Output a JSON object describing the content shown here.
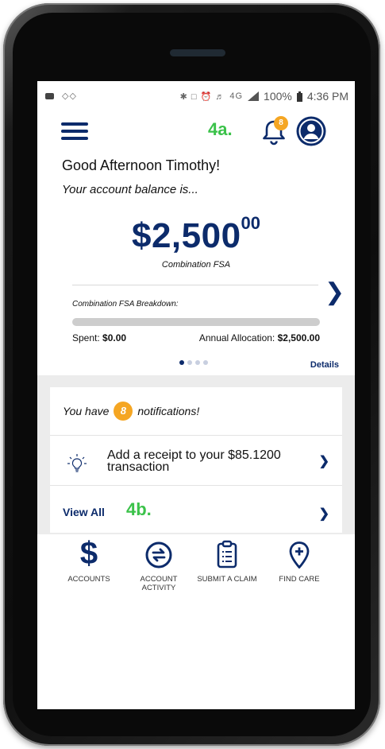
{
  "status_bar": {
    "battery": "100%",
    "time": "4:36 PM",
    "network": "4G"
  },
  "header": {
    "annotation_a": "4a.",
    "notification_count": "8"
  },
  "greeting": "Good Afternoon Timothy!",
  "balance": {
    "label": "Your account balance is...",
    "amount_main": "$2,500",
    "amount_cents": "00",
    "account_name": "Combination FSA",
    "breakdown_label": "Combination FSA Breakdown:",
    "spent_label": "Spent: ",
    "spent_value": "$0.00",
    "allocation_label": "Annual Allocation: ",
    "allocation_value": "$2,500.00",
    "progress_fraction": 0,
    "page_count": 4,
    "active_page": 1,
    "details_label": "Details"
  },
  "notifications": {
    "prefix": "You have",
    "count": "8",
    "suffix": "notifications!",
    "item_text": "Add a receipt to your $85.1200 transaction",
    "view_all_label": "View All",
    "annotation_b": "4b."
  },
  "nav": {
    "accounts": "ACCOUNTS",
    "account_activity": "ACCOUNT ACTIVITY",
    "submit_claim": "SUBMIT A CLAIM",
    "find_care": "FIND CARE"
  },
  "colors": {
    "brand": "#0c2b6b",
    "badge": "#f5a623",
    "annotation": "#3bc24a"
  },
  "icons": [
    "menu-icon",
    "bell-icon",
    "profile-icon",
    "lightbulb-icon",
    "dollar-icon",
    "transfer-icon",
    "clipboard-icon",
    "location-pin-icon"
  ]
}
